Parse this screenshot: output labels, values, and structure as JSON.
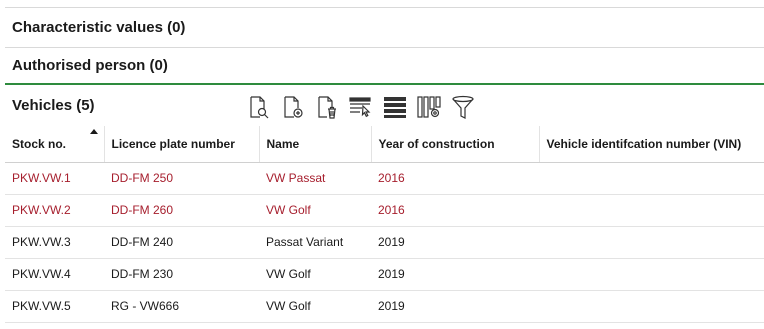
{
  "sections": {
    "characteristic_values": "Characteristic values (0)",
    "authorised_person": "Authorised person (0)",
    "vehicles": "Vehicles (5)"
  },
  "toolbar": {
    "icons": [
      "document-search-icon",
      "document-add-icon",
      "document-delete-icon",
      "column-select-icon",
      "list-view-icon",
      "column-settings-icon",
      "filter-icon"
    ]
  },
  "table": {
    "columns": [
      "Stock no.",
      "Licence plate number",
      "Name",
      "Year of construction",
      "Vehicle identifcation number (VIN)"
    ],
    "sorted_column": "Stock no.",
    "sort_direction": "ascending",
    "rows": [
      {
        "stock": "PKW.VW.1",
        "plate": "DD-FM 250",
        "name": "VW Passat",
        "year": "2016",
        "vin": "",
        "highlight": true
      },
      {
        "stock": "PKW.VW.2",
        "plate": "DD-FM 260",
        "name": "VW Golf",
        "year": "2016",
        "vin": "",
        "highlight": true
      },
      {
        "stock": "PKW.VW.3",
        "plate": "DD-FM 240",
        "name": "Passat Variant",
        "year": "2019",
        "vin": "",
        "highlight": false
      },
      {
        "stock": "PKW.VW.4",
        "plate": "DD-FM 230",
        "name": "VW Golf",
        "year": "2019",
        "vin": "",
        "highlight": false
      },
      {
        "stock": "PKW.VW.5",
        "plate": "RG - VW666",
        "name": "VW Golf",
        "year": "2019",
        "vin": "",
        "highlight": false
      }
    ]
  },
  "colors": {
    "accent_green": "#2e8b3e",
    "highlight_red": "#a61e2d"
  }
}
